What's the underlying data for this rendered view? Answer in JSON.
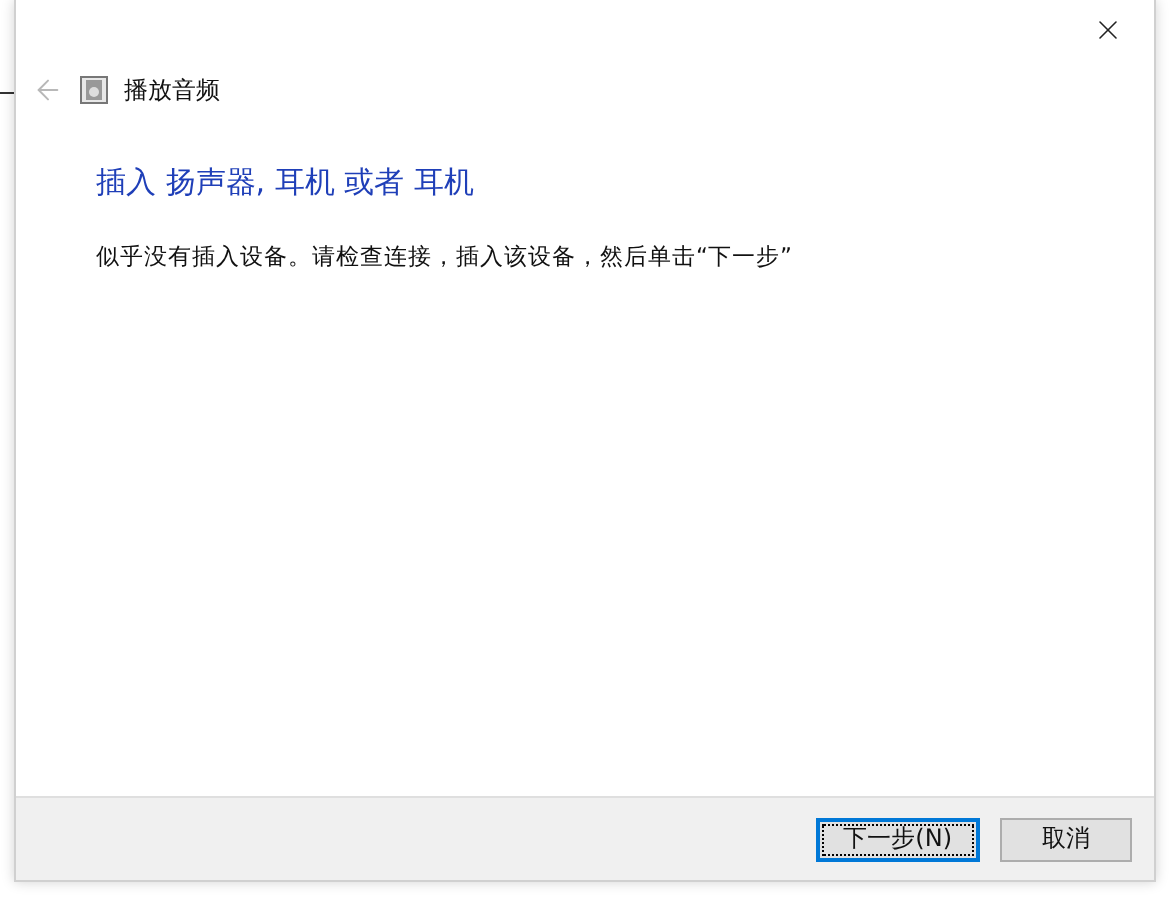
{
  "wizard": {
    "title": "播放音频"
  },
  "heading": "插入 扬声器, 耳机 或者 耳机",
  "message": "似乎没有插入设备。请检查连接，插入该设备，然后单击“下一步”",
  "buttons": [
    {
      "label": "下一步(N)",
      "default": true
    },
    {
      "label": "取消",
      "default": false
    }
  ]
}
